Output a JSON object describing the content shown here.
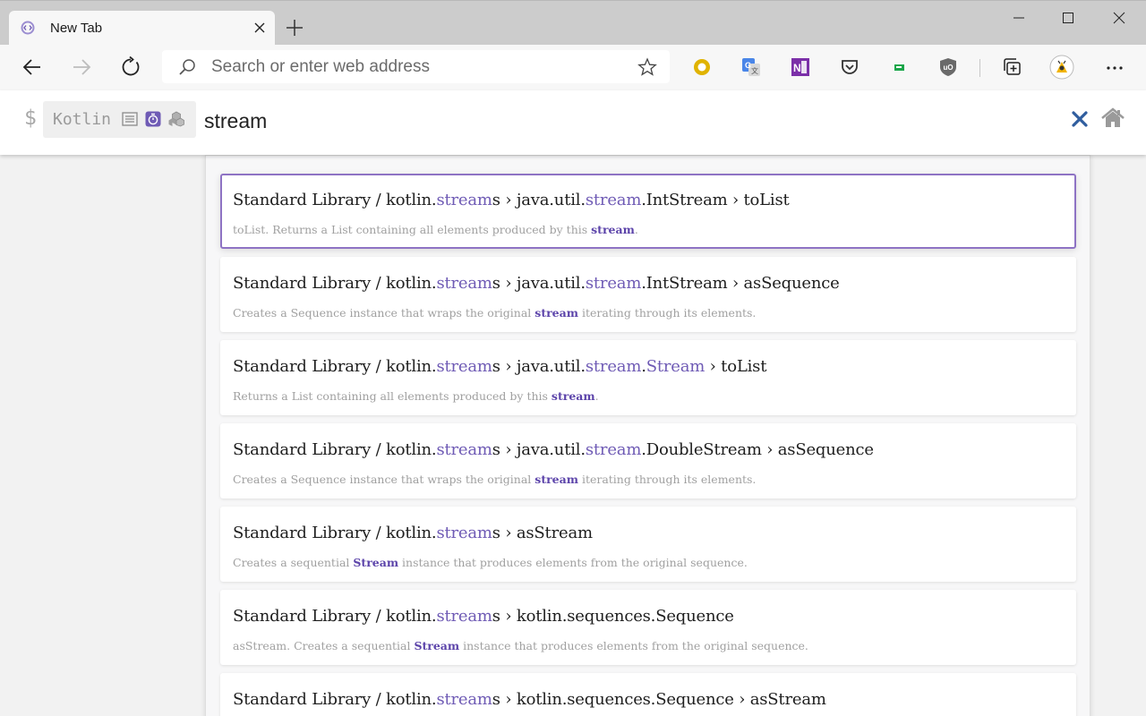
{
  "browser": {
    "tab_title": "New Tab",
    "address_placeholder": "Search or enter web address"
  },
  "search": {
    "prefix": "$",
    "scope": "Kotlin",
    "query": "stream"
  },
  "results": [
    {
      "title": [
        [
          "Standard Library / kotlin.",
          ""
        ],
        [
          "stream",
          "hl"
        ],
        [
          "s › java.util.",
          ""
        ],
        [
          "stream",
          "hl"
        ],
        [
          ".IntStream › toList",
          ""
        ]
      ],
      "desc": [
        [
          "toList. Returns a List containing all elements produced by this ",
          ""
        ],
        [
          "stream",
          "hlb"
        ],
        [
          ".",
          ""
        ]
      ]
    },
    {
      "title": [
        [
          "Standard Library / kotlin.",
          ""
        ],
        [
          "stream",
          "hl"
        ],
        [
          "s › java.util.",
          ""
        ],
        [
          "stream",
          "hl"
        ],
        [
          ".IntStream › asSequence",
          ""
        ]
      ],
      "desc": [
        [
          "Creates a Sequence instance that wraps the original ",
          ""
        ],
        [
          "stream",
          "hlb"
        ],
        [
          " iterating through its elements.",
          ""
        ]
      ]
    },
    {
      "title": [
        [
          "Standard Library / kotlin.",
          ""
        ],
        [
          "stream",
          "hl"
        ],
        [
          "s › java.util.",
          ""
        ],
        [
          "stream",
          "hl"
        ],
        [
          ".",
          ""
        ],
        [
          "Stream",
          "hl"
        ],
        [
          " › toList",
          ""
        ]
      ],
      "desc": [
        [
          "Returns a List containing all elements produced by this ",
          ""
        ],
        [
          "stream",
          "hlb"
        ],
        [
          ".",
          ""
        ]
      ]
    },
    {
      "title": [
        [
          "Standard Library / kotlin.",
          ""
        ],
        [
          "stream",
          "hl"
        ],
        [
          "s › java.util.",
          ""
        ],
        [
          "stream",
          "hl"
        ],
        [
          ".DoubleStream › asSequence",
          ""
        ]
      ],
      "desc": [
        [
          "Creates a Sequence instance that wraps the original ",
          ""
        ],
        [
          "stream",
          "hlb"
        ],
        [
          " iterating through its elements.",
          ""
        ]
      ]
    },
    {
      "title": [
        [
          "Standard Library / kotlin.",
          ""
        ],
        [
          "stream",
          "hl"
        ],
        [
          "s › asStream",
          ""
        ]
      ],
      "desc": [
        [
          "Creates a sequential ",
          ""
        ],
        [
          "Stream",
          "hlb"
        ],
        [
          " instance that produces elements from the original sequence.",
          ""
        ]
      ]
    },
    {
      "title": [
        [
          "Standard Library / kotlin.",
          ""
        ],
        [
          "stream",
          "hl"
        ],
        [
          "s › kotlin.sequences.Sequence",
          ""
        ]
      ],
      "desc": [
        [
          "asStream. Creates a sequential ",
          ""
        ],
        [
          "Stream",
          "hlb"
        ],
        [
          " instance that produces elements from the original sequence.",
          ""
        ]
      ]
    },
    {
      "title": [
        [
          "Standard Library / kotlin.",
          ""
        ],
        [
          "stream",
          "hl"
        ],
        [
          "s › kotlin.sequences.Sequence › asStream",
          ""
        ]
      ],
      "desc": []
    }
  ],
  "colors": {
    "highlight": "#6f5bb5",
    "selected_border": "#8e73c4"
  },
  "icons": {
    "tab": [
      "app-favicon",
      "close-icon"
    ],
    "toolbar": [
      "back-arrow-icon",
      "forward-arrow-icon",
      "refresh-icon",
      "search-icon",
      "star-icon"
    ],
    "extensions": [
      "ring-extension-icon",
      "google-translate-icon",
      "onenote-icon",
      "pocket-icon",
      "flag-extension-icon",
      "ublock-icon",
      "collections-icon",
      "profile-avatar-icon",
      "more-icon"
    ],
    "scope": [
      "list-icon",
      "timer-icon",
      "cubes-icon"
    ],
    "header": [
      "clear-x-icon",
      "home-icon"
    ]
  }
}
